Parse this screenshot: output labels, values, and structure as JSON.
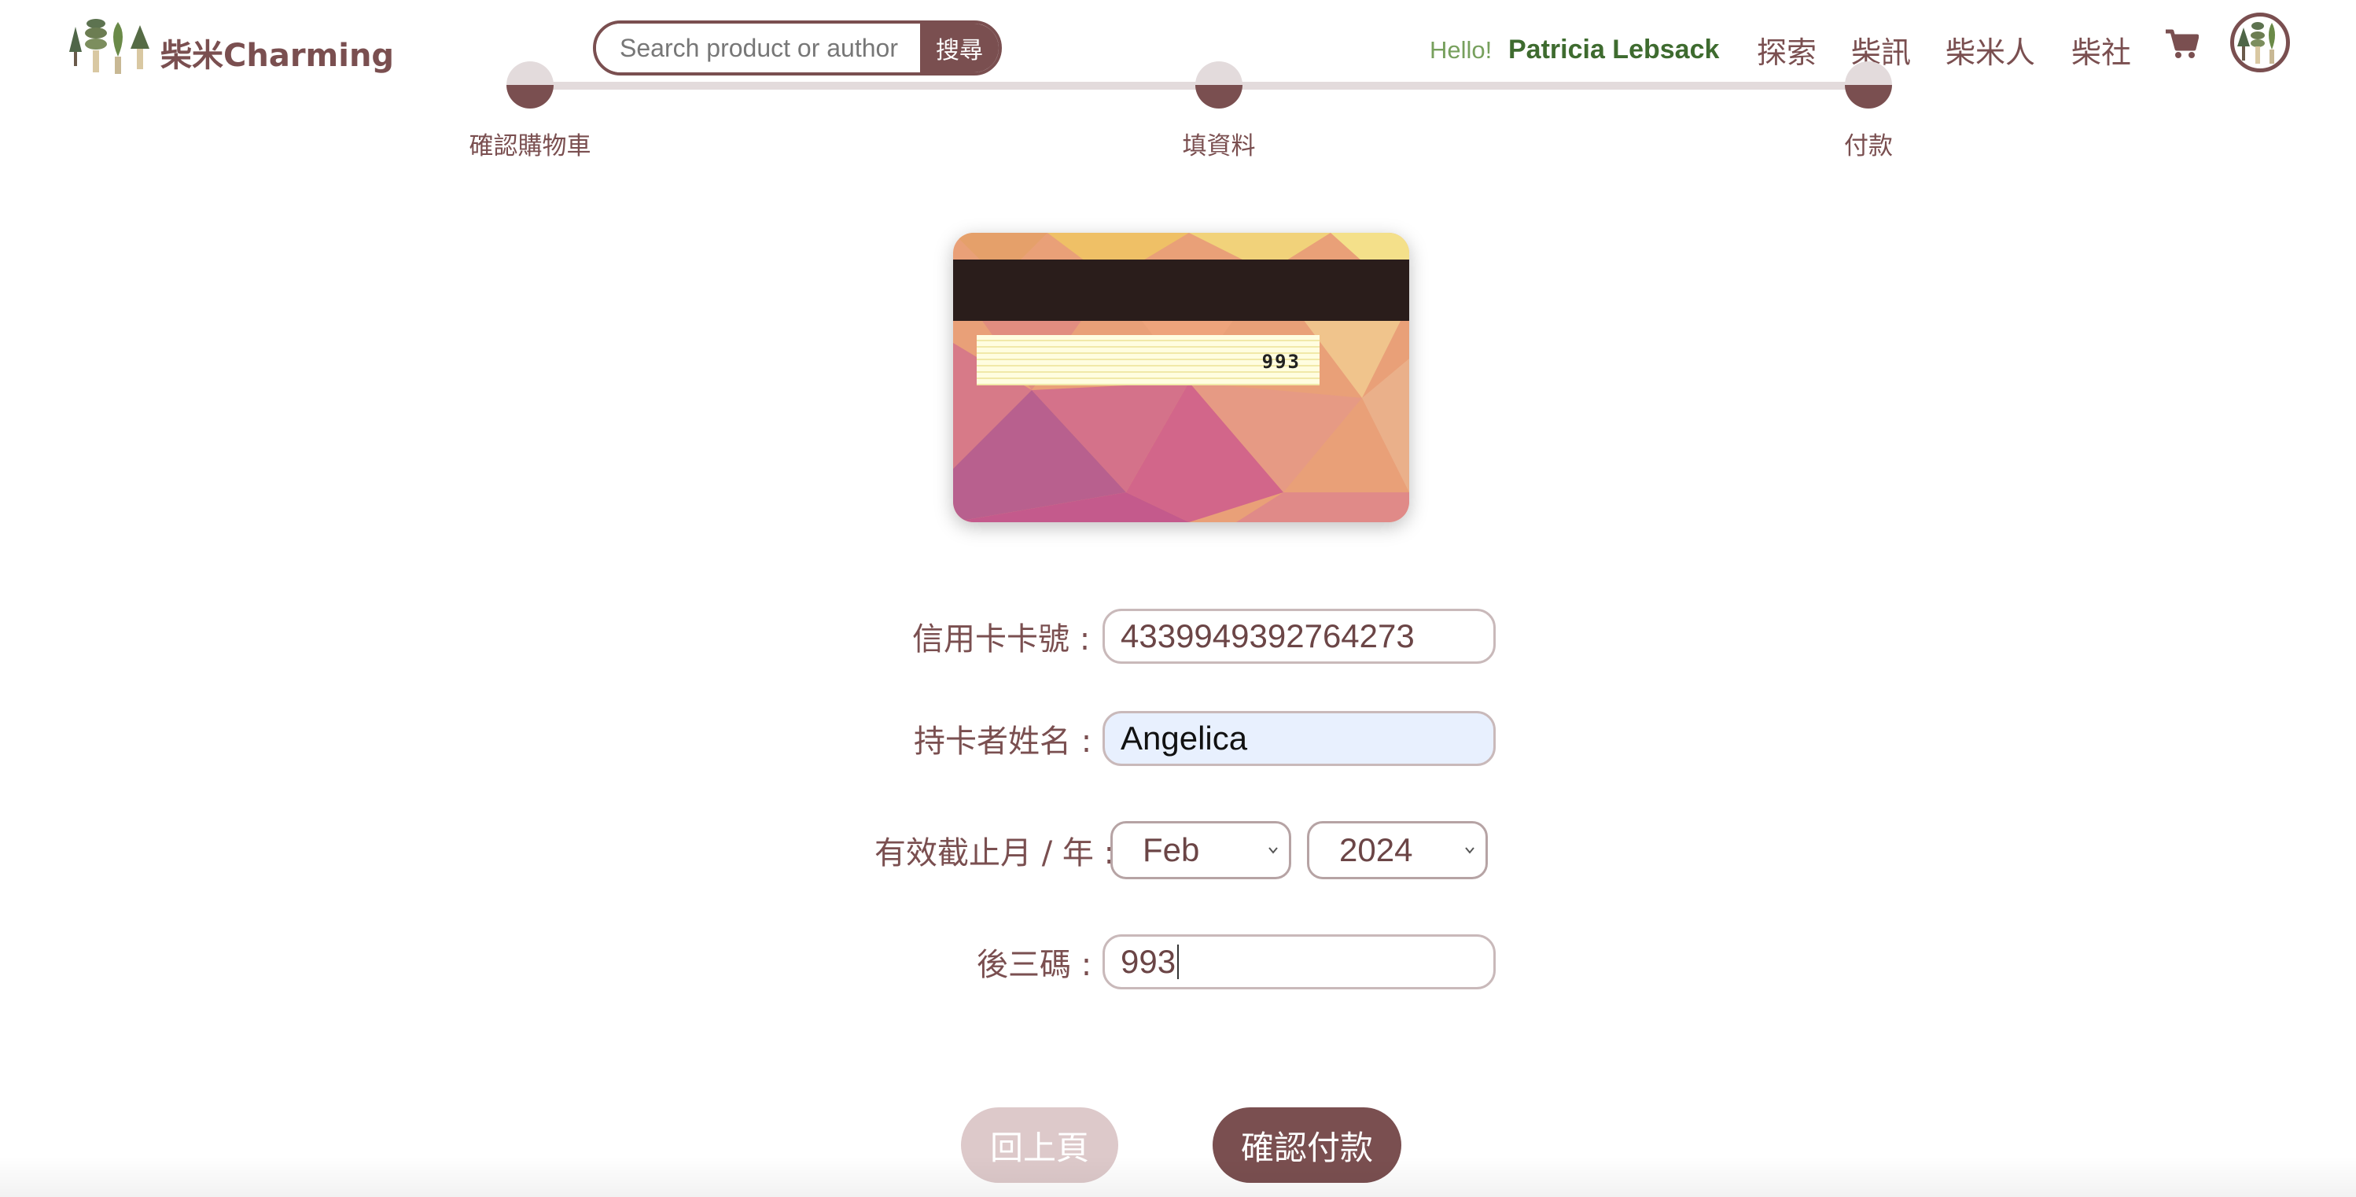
{
  "header": {
    "logo_text": "柴米Charming",
    "search_placeholder": "Search product or author",
    "search_button": "搜尋",
    "greeting": "Hello!",
    "username": "Patricia Lebsack",
    "nav": [
      "探索",
      "柴訊",
      "柴米人",
      "柴社"
    ]
  },
  "steps": [
    "確認購物車",
    "填資料",
    "付款"
  ],
  "card": {
    "cvv_display": "993"
  },
  "form": {
    "card_number_label": "信用卡卡號 :",
    "card_number_value": "4339949392764273",
    "holder_name_label": "持卡者姓名 :",
    "holder_name_value": "Angelica",
    "expiry_label": "有效截止月 / 年 :",
    "expiry_month": "Feb",
    "expiry_year": "2024",
    "cvv_label": "後三碼 :",
    "cvv_value": "993"
  },
  "buttons": {
    "back": "回上頁",
    "confirm": "確認付款"
  },
  "colors": {
    "brand": "#7a4f50",
    "green": "#3e6b2f",
    "autofill": "#e8f0fe"
  }
}
